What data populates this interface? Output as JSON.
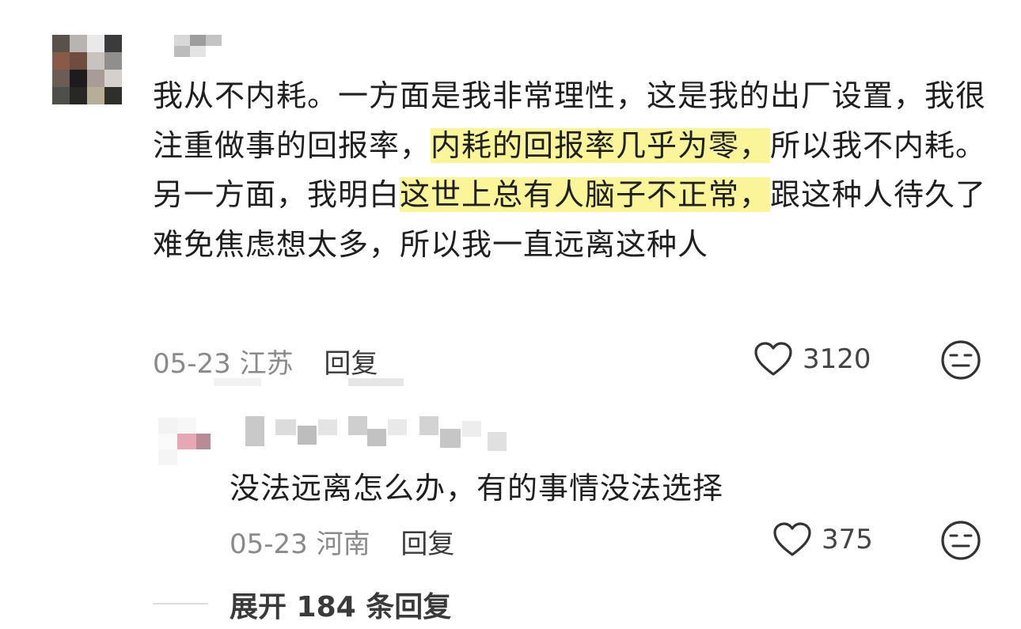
{
  "comment": {
    "text_before_hl1": "我从不内耗。一方面是我非常理性，这是我的出厂设置，我很注重做事的回报率，",
    "highlight_1": "内耗的回报率几乎为零，",
    "text_mid": "所以我不内耗。另一方面，我明白",
    "highlight_2": "这世上总有人脑子不正常，",
    "text_after": "跟这种人待久了难免焦虑想太多，所以我一直远离这种人",
    "date": "05-23",
    "location": "江苏",
    "reply_label": "回复",
    "like_count": "3120",
    "like_icon": "heart-outline-icon",
    "dislike_icon": "meh-face-icon"
  },
  "reply": {
    "text": "没法远离怎么办，有的事情没法选择",
    "date": "05-23",
    "location": "河南",
    "reply_label": "回复",
    "like_count": "375",
    "like_icon": "heart-outline-icon",
    "dislike_icon": "meh-face-icon"
  },
  "expand": {
    "label": "展开 184 条回复"
  },
  "colors": {
    "highlight": "#fbf59a",
    "meta_gray": "#8a8a8a",
    "text": "#1f1f1f"
  }
}
